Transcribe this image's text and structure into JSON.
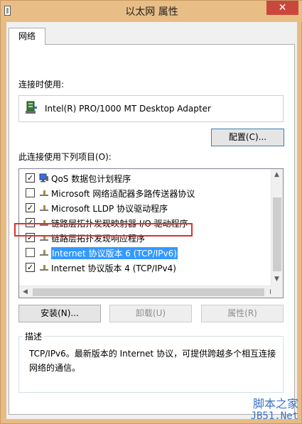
{
  "window": {
    "title": "以太网 属性",
    "close_glyph": "✕"
  },
  "tabs": [
    {
      "label": "网络"
    }
  ],
  "connection": {
    "connect_using_label": "连接时使用:",
    "adapter_name": "Intel(R) PRO/1000 MT Desktop Adapter",
    "configure_button": "配置(C)..."
  },
  "items_section": {
    "label": "此连接使用下列项目(O):",
    "items": [
      {
        "label": "QoS 数据包计划程序",
        "checked": true,
        "icon": "qos-icon"
      },
      {
        "label": "Microsoft 网络适配器多路传送器协议",
        "checked": false,
        "icon": "protocol-icon"
      },
      {
        "label": "Microsoft LLDP 协议驱动程序",
        "checked": true,
        "icon": "protocol-icon"
      },
      {
        "label": "链路层拓扑发现映射器 I/O 驱动程序",
        "checked": true,
        "icon": "protocol-icon"
      },
      {
        "label": "链路层拓扑发现响应程序",
        "checked": true,
        "icon": "protocol-icon"
      },
      {
        "label": "Internet 协议版本 6 (TCP/IPv6)",
        "checked": false,
        "icon": "protocol-icon",
        "selected": true
      },
      {
        "label": "Internet 协议版本 4 (TCP/IPv4)",
        "checked": true,
        "icon": "protocol-icon"
      }
    ]
  },
  "buttons": {
    "install": "安装(N)...",
    "uninstall": "卸载(U)",
    "properties": "属性(R)"
  },
  "description": {
    "title": "描述",
    "text": "TCP/IPv6。最新版本的 Internet 协议，可提供跨越多个相互连接网络的通信。"
  },
  "watermark": {
    "line1": "脚本之家",
    "line2": "JB51.Net"
  },
  "colors": {
    "title_bar": "#e8bd86",
    "close_button": "#c9483b",
    "selection": "#3399ff",
    "annotation_box": "#e03030"
  }
}
